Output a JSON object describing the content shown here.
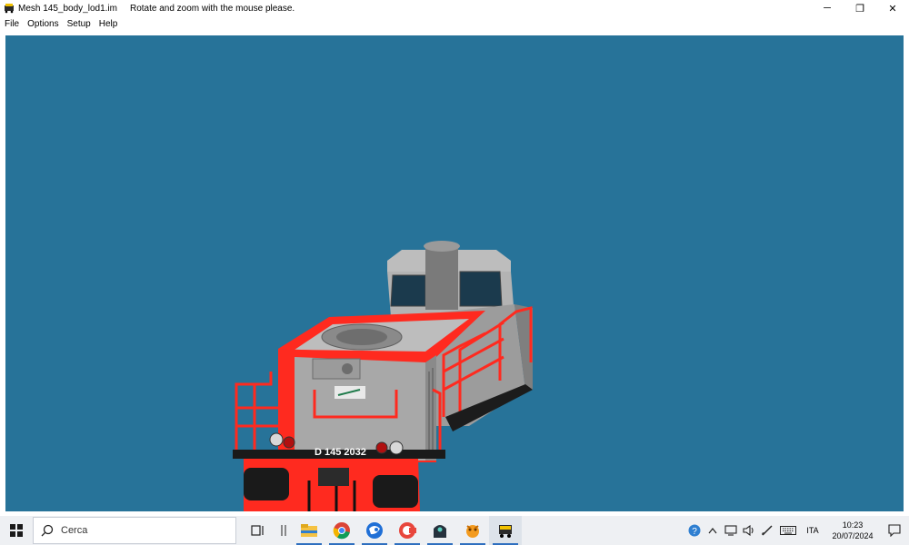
{
  "window": {
    "title": "Mesh 145_body_lod1.im",
    "hint": "Rotate and zoom with the mouse please.",
    "minimize_label": "─",
    "restore_label": "❐",
    "close_label": "✕"
  },
  "menu": {
    "items": [
      "File",
      "Options",
      "Setup",
      "Help"
    ]
  },
  "viewport": {
    "background": "#277399",
    "model_number_label": "D 145 2032"
  },
  "taskbar": {
    "search_placeholder": "Cerca",
    "apps": [
      "task-view",
      "divider",
      "file-explorer",
      "chrome",
      "thunderbird",
      "ccleaner",
      "app-dark",
      "app-orange",
      "mesh-viewer"
    ],
    "tray": {
      "language": "ITA",
      "time": "10:23",
      "date": "20/07/2024"
    }
  },
  "colors": {
    "locomotive_red": "#ff2a1f",
    "locomotive_grey": "#a8a8a8",
    "taskbar_bg": "#eef0f3"
  }
}
